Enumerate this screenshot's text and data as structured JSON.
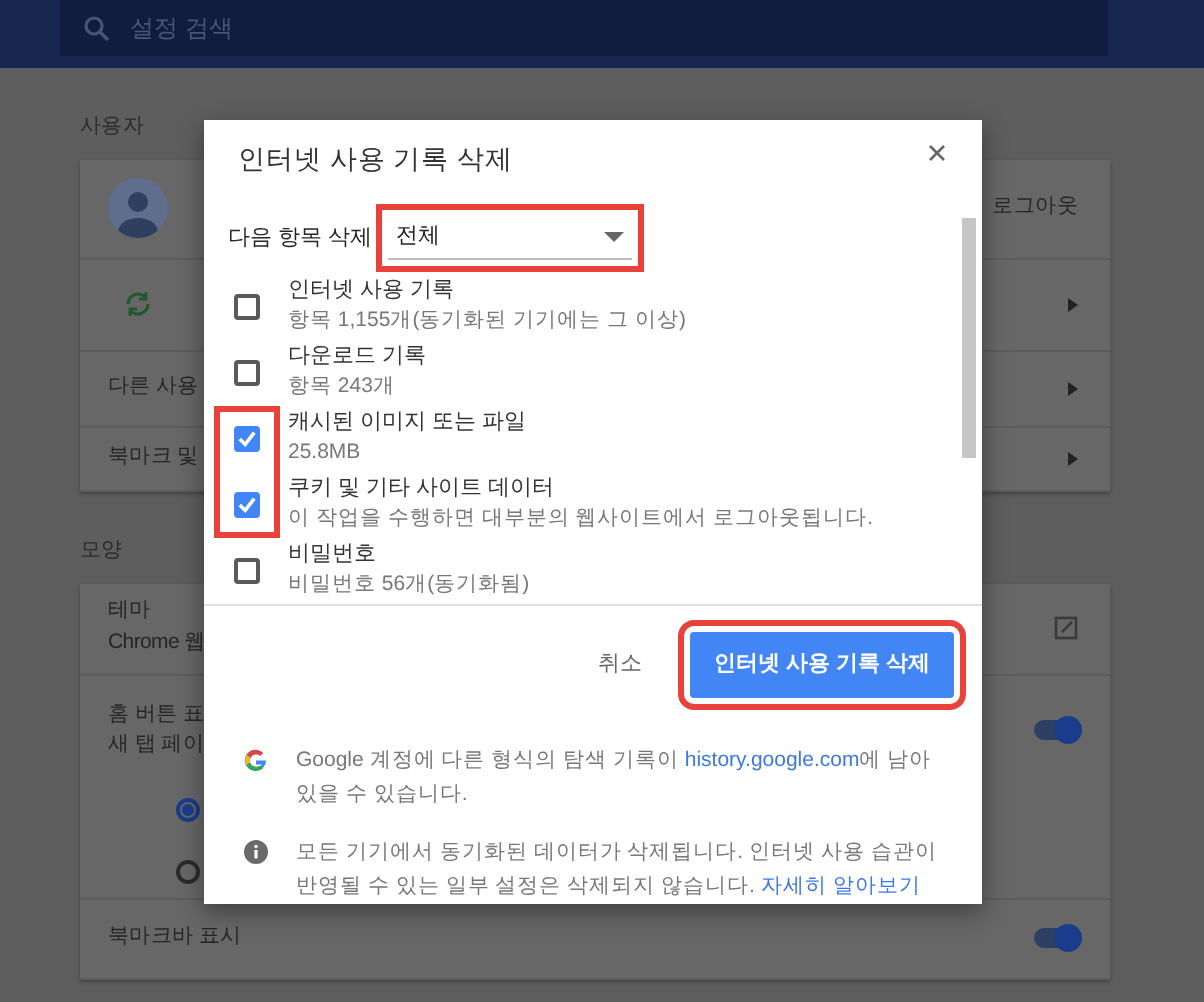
{
  "background": {
    "search": {
      "placeholder": "설정 검색"
    },
    "people": {
      "title": "사용자",
      "profile": {
        "action": "로그아웃"
      },
      "links": [
        "다른 사용",
        "북마크 및"
      ]
    },
    "appearance": {
      "title": "모양",
      "theme": {
        "title": "테마",
        "detail": "Chrome 웹"
      },
      "home_button": {
        "title": "홈 버튼 표",
        "detail": "새 탭 페이",
        "on": true,
        "options": [
          {
            "selected": true
          },
          {
            "selected": false
          }
        ]
      },
      "bookmarks_bar": {
        "title": "북마크바 표시",
        "on": true
      }
    }
  },
  "dialog": {
    "title": "인터넷 사용 기록 삭제",
    "range_label": "다음 항목 삭제",
    "range_value": "전체",
    "items": [
      {
        "title": "인터넷 사용 기록",
        "detail": "항목 1,155개(동기화된 기기에는 그 이상)",
        "checked": false
      },
      {
        "title": "다운로드 기록",
        "detail": "항목 243개",
        "checked": false
      },
      {
        "title": "캐시된 이미지 또는 파일",
        "detail": "25.8MB",
        "checked": true
      },
      {
        "title": "쿠키 및 기타 사이트 데이터",
        "detail": "이 작업을 수행하면 대부분의 웹사이트에서 로그아웃됩니다.",
        "checked": true
      },
      {
        "title": "비밀번호",
        "detail": "비밀번호 56개(동기화됨)",
        "checked": false
      }
    ],
    "cancel": "취소",
    "confirm": "인터넷 사용 기록 삭제",
    "notes": [
      {
        "kind": "google",
        "text": "Google 계정에 다른 형식의 탐색 기록이 ",
        "link": "history.google.com",
        "after": "에 남아있을 수 있습니다."
      },
      {
        "kind": "info",
        "text": "모든 기기에서 동기화된 데이터가 삭제됩니다. 인터넷 사용 습관이 반영될 수 있는 일부 설정은 삭제되지 않습니다. ",
        "link": "자세히 알아보기"
      }
    ]
  },
  "annotations": [
    {
      "kind": "range"
    },
    {
      "kind": "checked_items"
    },
    {
      "kind": "confirm"
    }
  ]
}
